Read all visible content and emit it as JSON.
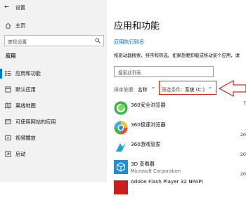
{
  "window": {
    "title": "设置"
  },
  "nav": {
    "home": "主页",
    "search_placeholder": "查找设置",
    "section": "应用",
    "items": [
      "应用和功能",
      "默认应用",
      "离线地图",
      "可使用网站的应用",
      "视频播放",
      "启动"
    ]
  },
  "main": {
    "title": "应用和功能",
    "alias_link": "应用执行别名",
    "desc": "按驱动器搜索、排序和筛选。如果想要卸载或移动某个应用，请",
    "search_placeholder": "搜索此列表",
    "sort_label": "排序依据:",
    "sort_value": "名称",
    "filter_label": "筛选条件:",
    "filter_value": "系统 (C:)"
  },
  "apps": [
    {
      "name": "360安全浏览器",
      "publisher": "",
      "edge_top": "7",
      "edge_bottom": ""
    },
    {
      "name": "360极速浏览器",
      "publisher": "",
      "edge_top": "",
      "edge_bottom": "20"
    },
    {
      "name": "360游戏管家",
      "publisher": "",
      "edge_top": "",
      "edge_bottom": "20"
    },
    {
      "name": "3D 查看器",
      "publisher": "Microsoft Corporation",
      "edge_top": "",
      "edge_bottom": "20"
    },
    {
      "name": "Adobe Flash Player 32 NPAPI",
      "publisher": "",
      "edge_top": "",
      "edge_bottom": ""
    }
  ],
  "colors": {
    "accent": "#0078d7",
    "annotation": "#e0201c"
  }
}
